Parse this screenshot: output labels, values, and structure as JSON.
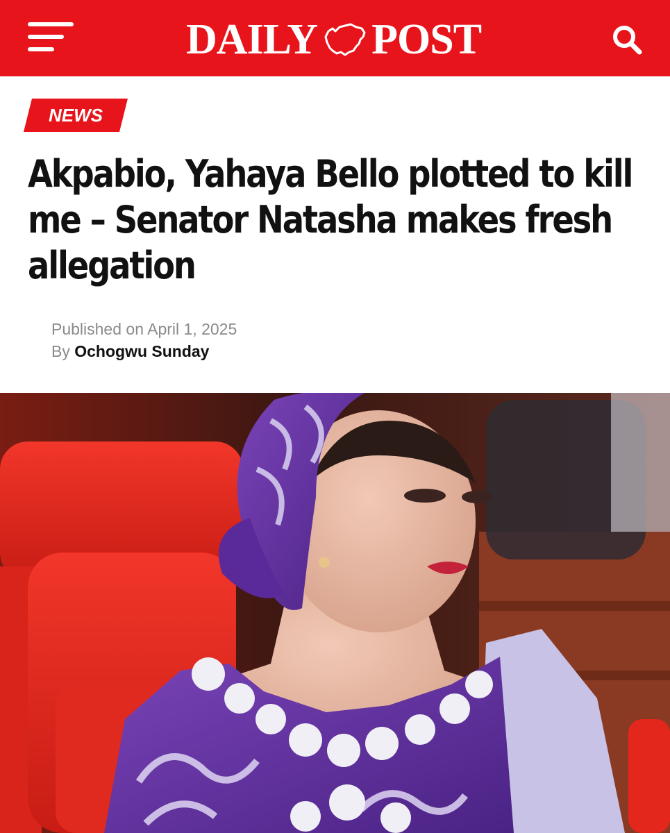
{
  "header": {
    "logo_left": "DAILY",
    "logo_right": "POST",
    "background_color": "#e8141b",
    "icons": {
      "menu": "hamburger-menu-icon",
      "search": "search-icon",
      "logo_mark": "nigeria-map-icon"
    }
  },
  "article": {
    "category": "NEWS",
    "headline_lines": [
      "Akpabio, Yahaya Bello plotted to kill",
      "me – Senator Natasha makes fresh",
      "allegation"
    ],
    "published_prefix": "Published on",
    "published_date": "April 1, 2025",
    "by_prefix": "By",
    "author": "Ochogwu Sunday"
  },
  "colors": {
    "accent": "#e8141b",
    "text": "#111111",
    "meta_text": "#8a8a8a",
    "photo_seat_red": "#e8251c",
    "photo_attire_purple": "#6a3aa5",
    "photo_scarf_lavender": "#c8c2e6"
  }
}
